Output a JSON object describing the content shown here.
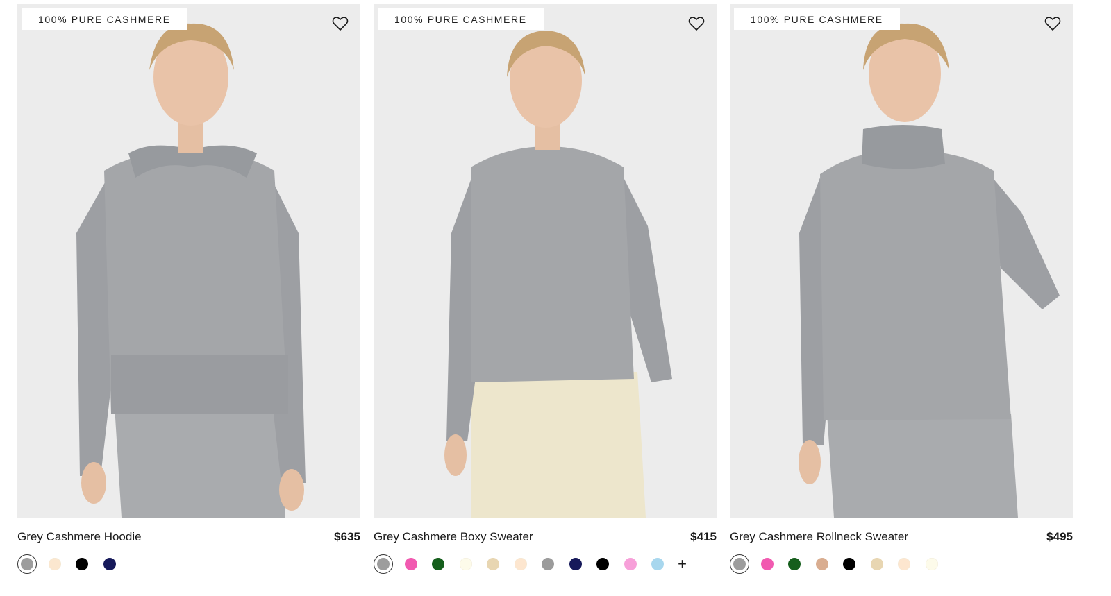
{
  "products": [
    {
      "badge": "100% PURE CASHMERE",
      "name": "Grey Cashmere Hoodie",
      "price": "$635",
      "image_icon": "model-photo-hoodie",
      "swatches": [
        {
          "color": "#9d9d9d",
          "selected": true
        },
        {
          "color": "#fbe7cf",
          "selected": false
        },
        {
          "color": "#000000",
          "selected": false
        },
        {
          "color": "#16195a",
          "selected": false
        }
      ],
      "more_label": ""
    },
    {
      "badge": "100% PURE CASHMERE",
      "name": "Grey Cashmere Boxy Sweater",
      "price": "$415",
      "image_icon": "model-photo-boxy-sweater",
      "swatches": [
        {
          "color": "#9d9d9d",
          "selected": true
        },
        {
          "color": "#f15ab0",
          "selected": false
        },
        {
          "color": "#155e1c",
          "selected": false
        },
        {
          "color": "#fdfbea",
          "selected": false
        },
        {
          "color": "#e8d6b2",
          "selected": false
        },
        {
          "color": "#fde6cf",
          "selected": false
        },
        {
          "color": "#9b9b9b",
          "selected": false
        },
        {
          "color": "#16195a",
          "selected": false
        },
        {
          "color": "#000000",
          "selected": false
        },
        {
          "color": "#f7a0d9",
          "selected": false
        },
        {
          "color": "#a8d7ee",
          "selected": false
        }
      ],
      "more_label": "+"
    },
    {
      "badge": "100% PURE CASHMERE",
      "name": "Grey Cashmere Rollneck Sweater",
      "price": "$495",
      "image_icon": "model-photo-rollneck",
      "swatches": [
        {
          "color": "#9d9d9d",
          "selected": true
        },
        {
          "color": "#f15ab0",
          "selected": false
        },
        {
          "color": "#155e1c",
          "selected": false
        },
        {
          "color": "#d9ad90",
          "selected": false
        },
        {
          "color": "#000000",
          "selected": false
        },
        {
          "color": "#e8d6b2",
          "selected": false
        },
        {
          "color": "#fde6cf",
          "selected": false
        },
        {
          "color": "#fdfbea",
          "selected": false
        }
      ],
      "more_label": ""
    }
  ],
  "icons": {
    "wishlist": "heart-outline-icon"
  },
  "colors": {
    "photo_bg": "#ececec",
    "sweater": "#a4a6a9",
    "trouser_cream": "#ede6cc",
    "skin": "#e9c3a8",
    "hair": "#c7a373"
  }
}
